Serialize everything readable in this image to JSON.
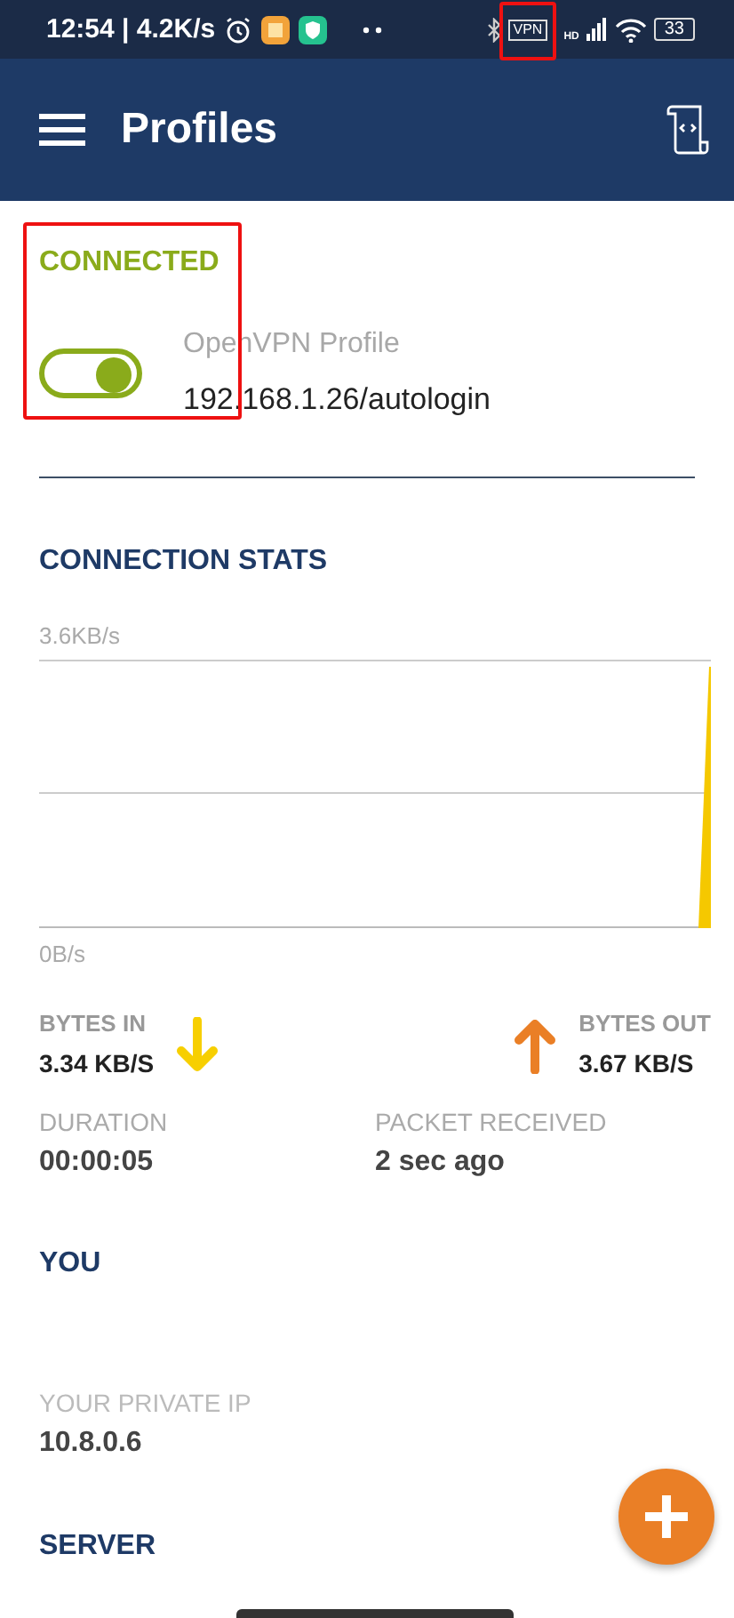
{
  "status_bar": {
    "time": "12:54 | 4.2K/s",
    "vpn_label": "VPN",
    "vpn_highlighted": true,
    "network_label": "HD",
    "battery": "33"
  },
  "app_bar": {
    "title": "Profiles"
  },
  "profile": {
    "status": "CONNECTED",
    "highlighted": true,
    "on": true,
    "name": "OpenVPN Profile",
    "address": "192.168.1.26/autologin"
  },
  "stats": {
    "title": "CONNECTION STATS",
    "graph": {
      "kind": "picture",
      "top_label": "3.6KB/s",
      "bottom_label": "0B/s"
    },
    "bytes_in": {
      "label": "BYTES IN",
      "value": "3.34 KB/S"
    },
    "bytes_out": {
      "label": "BYTES OUT",
      "value": "3.67 KB/S"
    },
    "duration": {
      "label": "DURATION",
      "value": "00:00:05"
    },
    "packet": {
      "label": "PACKET RECEIVED",
      "value": "2 sec ago"
    }
  },
  "you": {
    "title": "YOU",
    "fields": [
      {
        "label": "YOUR PRIVATE IP",
        "value": "10.8.0.6"
      }
    ]
  },
  "server": {
    "title": "SERVER"
  }
}
